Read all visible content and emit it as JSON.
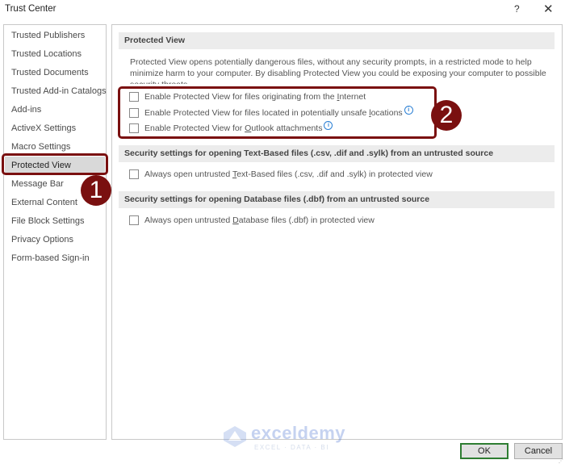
{
  "window": {
    "title": "Trust Center",
    "help_label": "?",
    "close_label": "✕"
  },
  "sidebar": {
    "items": [
      {
        "label": "Trusted Publishers"
      },
      {
        "label": "Trusted Locations"
      },
      {
        "label": "Trusted Documents"
      },
      {
        "label": "Trusted Add-in Catalogs"
      },
      {
        "label": "Add-ins"
      },
      {
        "label": "ActiveX Settings"
      },
      {
        "label": "Macro Settings"
      },
      {
        "label": "Protected View",
        "selected": true
      },
      {
        "label": "Message Bar"
      },
      {
        "label": "External Content"
      },
      {
        "label": "File Block Settings"
      },
      {
        "label": "Privacy Options"
      },
      {
        "label": "Form-based Sign-in"
      }
    ]
  },
  "main": {
    "protected_view": {
      "header": "Protected View",
      "description": "Protected View opens potentially dangerous files, without any security prompts, in a restricted mode to help minimize harm to your computer. By disabling Protected View you could be exposing your computer to possible security threats.",
      "options": [
        {
          "pre": "Enable Protected View for files originating from the ",
          "key": "I",
          "post": "nternet",
          "checked": false,
          "info": false
        },
        {
          "pre": "Enable Protected View for files located in potentially unsafe ",
          "key": "l",
          "post": "ocations",
          "checked": false,
          "info": true
        },
        {
          "pre": "Enable Protected View for ",
          "key": "O",
          "post": "utlook attachments",
          "checked": false,
          "info": true
        }
      ]
    },
    "text_based": {
      "header": "Security settings for opening Text-Based files (.csv, .dif and .sylk) from an untrusted source",
      "option": {
        "pre": "Always open untrusted ",
        "key": "T",
        "post": "ext-Based files (.csv, .dif and .sylk) in protected view",
        "checked": false
      }
    },
    "database": {
      "header": "Security settings for opening Database files (.dbf) from an untrusted source",
      "option": {
        "pre": "Always open untrusted ",
        "key": "D",
        "post": "atabase files (.dbf) in protected view",
        "checked": false
      }
    }
  },
  "annotations": {
    "badge_1": "1",
    "badge_2": "2",
    "highlight_color": "#7a1010"
  },
  "info_icon_glyph": "i",
  "buttons": {
    "ok": "OK",
    "cancel": "Cancel"
  },
  "watermark": {
    "brand": "exceldemy",
    "tagline": "EXCEL · DATA · BI"
  }
}
